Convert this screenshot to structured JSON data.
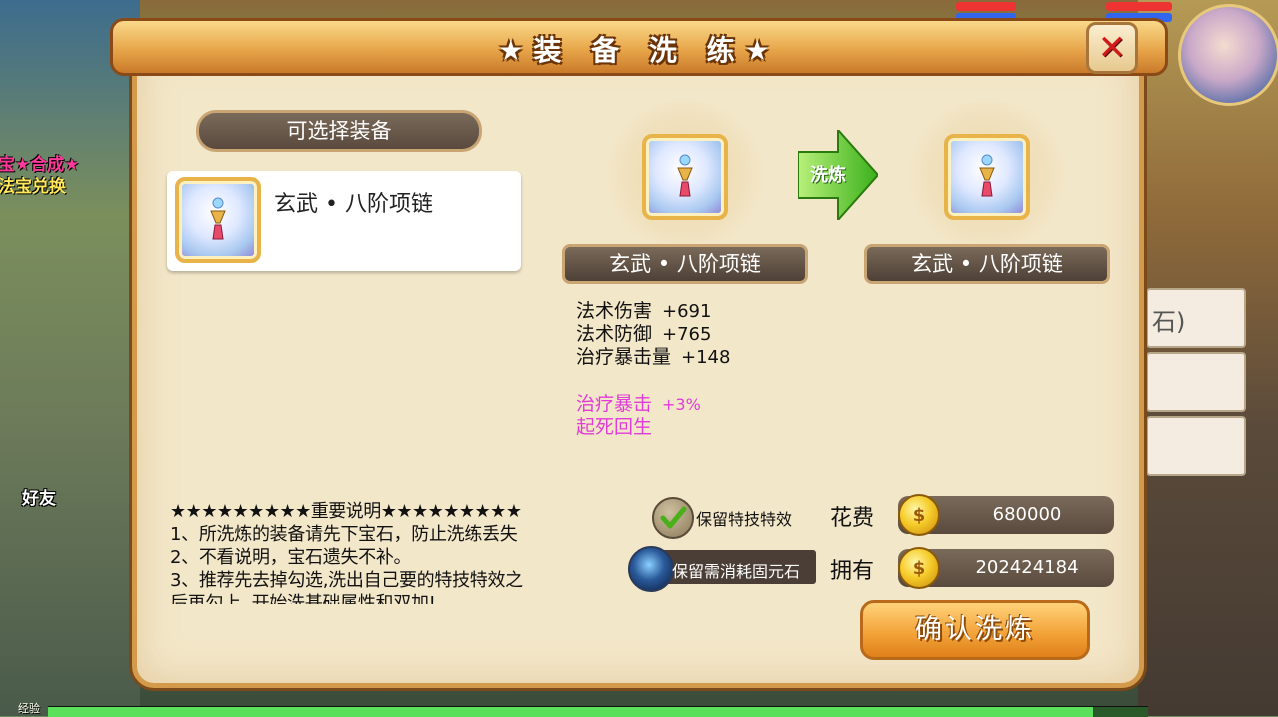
{
  "dialog": {
    "title": "★装 备 洗 练★",
    "close_label": "✕"
  },
  "left": {
    "header": "可选择装备",
    "items": [
      {
        "name": "玄武 • 八阶项链"
      }
    ]
  },
  "preview": {
    "arrow_label": "洗炼",
    "current_name": "玄武 • 八阶项链",
    "result_name": "玄武 • 八阶项链"
  },
  "stats": [
    {
      "name": "法术伤害",
      "value": "+691"
    },
    {
      "name": "法术防御",
      "value": "+765"
    },
    {
      "name": "治疗暴击量",
      "value": "+148"
    }
  ],
  "special_stats": [
    {
      "name": "治疗暴击",
      "value": "+3%"
    },
    {
      "name": "起死回生",
      "value": ""
    }
  ],
  "notes": {
    "title": "★★★★★★★★★重要说明★★★★★★★★★",
    "lines": [
      "1、所洗炼的装备请先下宝石，防止洗练丢失",
      "2、不看说明，宝石遗失不补。",
      "3、推荐先去掉勾选,洗出自己要的特技特效之",
      "后再勾上, 开始洗基础属性和双加!"
    ]
  },
  "options": {
    "keep_special": "保留特技特效",
    "keep_gem": "保留需消耗固元石"
  },
  "cost": {
    "cost_label": "花费",
    "cost_value": "680000",
    "own_label": "拥有",
    "own_value": "202424184"
  },
  "confirm_button": "确认洗炼",
  "background": {
    "side_text_1": "宝★合成★",
    "side_text_2": "法宝兑换",
    "friend_label": "好友",
    "exp_label": "经验",
    "right_hint": "石)",
    "exp_fraction": 0.95
  },
  "colors": {
    "frame": "#d29a4a",
    "panel": "#f3e7c9",
    "special_stat": "#e23cd8",
    "close": "#d21a1a"
  }
}
